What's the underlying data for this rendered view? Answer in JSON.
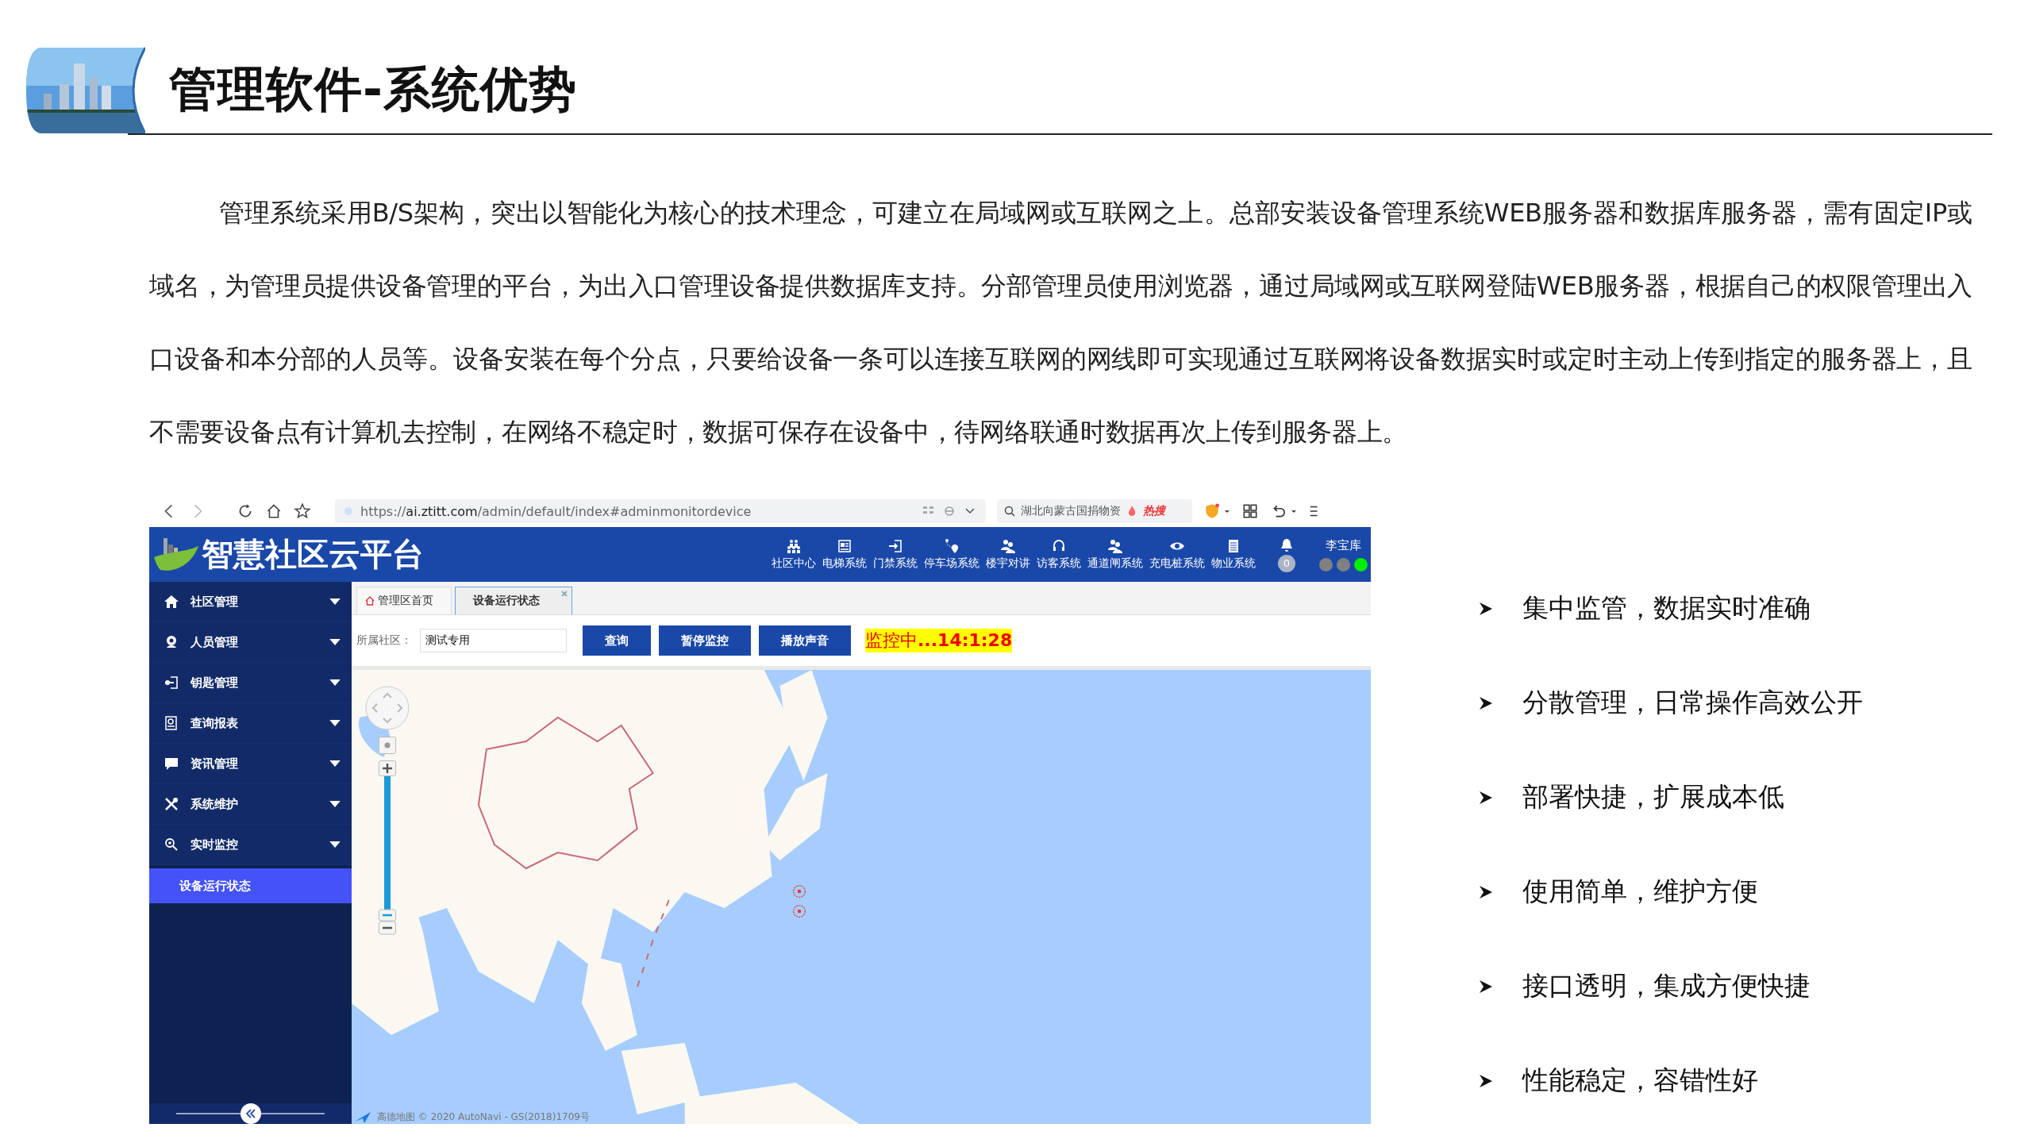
{
  "slide": {
    "title": "管理软件-系统优势",
    "paragraph": "管理系统采用B/S架构，突出以智能化为核心的技术理念，可建立在局域网或互联网之上。总部安装设备管理系统WEB服务器和数据库服务器，需有固定IP或域名，为管理员提供设备管理的平台，为出入口管理设备提供数据库支持。分部管理员使用浏览器，通过局域网或互联网登陆WEB服务器，根据自己的权限管理出入口设备和本分部的人员等。设备安装在每个分点，只要给设备一条可以连接互联网的网线即可实现通过互联网将设备数据实时或定时主动上传到指定的服务器上，且不需要设备点有计算机去控制，在网络不稳定时，数据可保存在设备中，待网络联通时数据再次上传到服务器上。",
    "bullets": [
      "集中监管，数据实时准确",
      "分散管理，日常操作高效公开",
      "部署快捷，扩展成本低",
      "使用简单，维护方便",
      "接口透明，集成方便快捷",
      "性能稳定，容错性好"
    ]
  },
  "browser": {
    "url_scheme": "https://",
    "url_host": "ai.ztitt.com",
    "url_path": "/admin/default/index#adminmonitordevice",
    "search": "湖北向蒙古国捐物资",
    "hot_badge": "热搜"
  },
  "app": {
    "title": "智慧社区云平台",
    "nav": [
      "社区中心",
      "电梯系统",
      "门禁系统",
      "停车场系统",
      "楼宇对讲",
      "访客系统",
      "通道闸系统",
      "充电桩系统",
      "物业系统"
    ],
    "notifications": "0",
    "user": "李宝库",
    "status_dots": [
      {
        "color": "#808080"
      },
      {
        "color": "#808080"
      },
      {
        "color": "#00ee00"
      }
    ]
  },
  "sidebar": {
    "items": [
      {
        "label": "社区管理"
      },
      {
        "label": "人员管理"
      },
      {
        "label": "钥匙管理"
      },
      {
        "label": "查询报表"
      },
      {
        "label": "资讯管理"
      },
      {
        "label": "系统维护"
      },
      {
        "label": "实时监控",
        "children": [
          {
            "label": "设备运行状态",
            "selected": true
          }
        ]
      }
    ]
  },
  "tabs": [
    {
      "label": "管理区首页",
      "selected": false,
      "closable": false
    },
    {
      "label": "设备运行状态",
      "selected": true,
      "closable": true
    }
  ],
  "toolbar": {
    "community_label": "所属社区：",
    "community_value": "测试专用",
    "buttons": [
      "查询",
      "暂停监控",
      "播放声音"
    ],
    "status_prefix": "监控中",
    "status_time": "...14:1:28"
  },
  "map": {
    "attribution": "高德地图 © 2020 AutoNavi - GS(2018)1709号"
  }
}
